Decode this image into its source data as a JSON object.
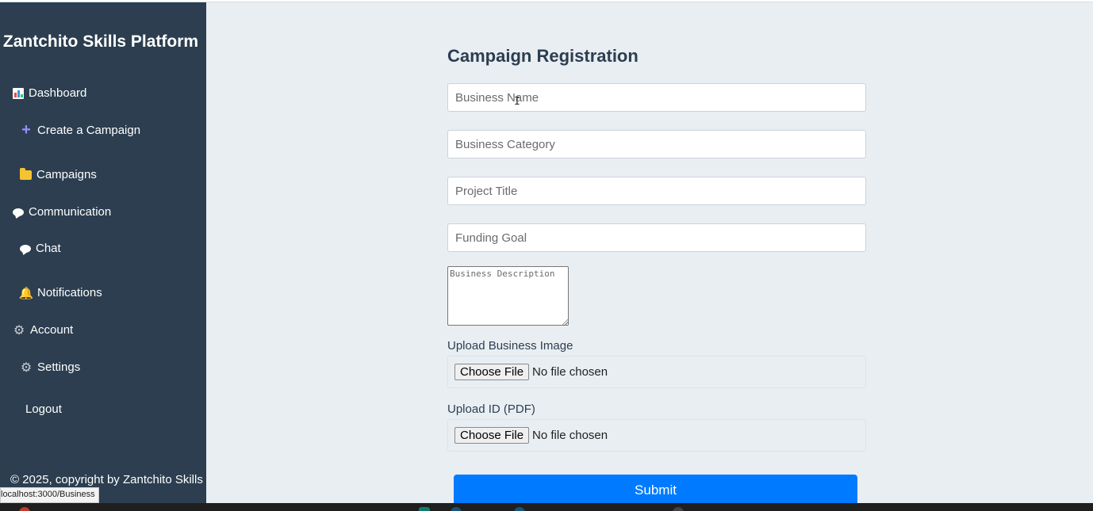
{
  "sidebar": {
    "brand": "Zantchito Skills Platform",
    "items": [
      {
        "label": "Dashboard",
        "icon": "bar-chart-icon"
      },
      {
        "label": "Create a Campaign",
        "icon": "plus-icon"
      },
      {
        "label": "Campaigns",
        "icon": "folder-icon"
      },
      {
        "label": "Communication",
        "icon": "speech-bubble-icon"
      },
      {
        "label": "Chat",
        "icon": "speech-bubble-icon"
      },
      {
        "label": "Notifications",
        "icon": "bell-icon"
      },
      {
        "label": "Account",
        "icon": "gear-icon"
      },
      {
        "label": "Settings",
        "icon": "gear-icon"
      },
      {
        "label": "Logout",
        "icon": ""
      }
    ],
    "footer": "© 2025, copyright by Zantchito Skills"
  },
  "status_bar": {
    "url": "localhost:3000/Business"
  },
  "form": {
    "title": "Campaign Registration",
    "business_name": {
      "placeholder": "Business Name",
      "value": ""
    },
    "business_category": {
      "placeholder": "Business Category",
      "value": ""
    },
    "project_title": {
      "placeholder": "Project Title",
      "value": ""
    },
    "funding_goal": {
      "placeholder": "Funding Goal",
      "value": ""
    },
    "business_description": {
      "placeholder": "Business Description",
      "value": ""
    },
    "upload_image": {
      "label": "Upload Business Image",
      "button": "Choose File",
      "status": "No file chosen"
    },
    "upload_id": {
      "label": "Upload ID (PDF)",
      "button": "Choose File",
      "status": "No file chosen"
    },
    "submit_label": "Submit"
  },
  "colors": {
    "sidebar_bg": "#2c3e50",
    "page_bg": "#e9eef2",
    "primary": "#007bff",
    "heading": "#2c3e50"
  }
}
